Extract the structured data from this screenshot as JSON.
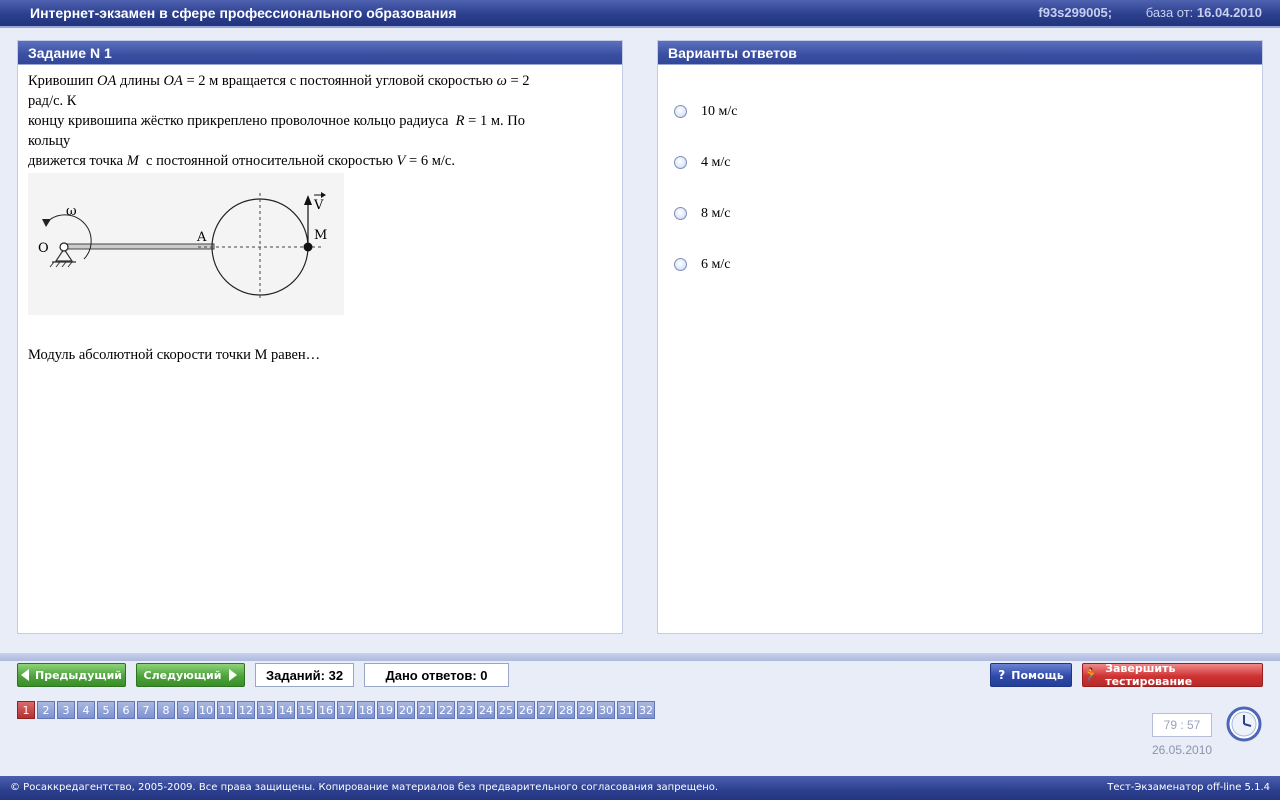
{
  "window": {
    "title": "Интернет-экзамен в сфере профессионального образования",
    "session_id": "f93s299005;",
    "base_label": "база от:",
    "base_date": "16.04.2010"
  },
  "task": {
    "header": "Задание N 1",
    "figure_labels": {
      "omega": "ω",
      "o": "O",
      "a": "A",
      "m": "M",
      "v": "V"
    },
    "question": "Модуль абсолютной скорости точки M равен…"
  },
  "answers": {
    "header": "Варианты ответов",
    "options": [
      "10 м/с",
      "4 м/с",
      "8 м/с",
      "6 м/с"
    ]
  },
  "toolbar": {
    "prev_label": "Предыдущий",
    "next_label": "Следующий",
    "tasks_count_label": "Заданий: 32",
    "answers_count_label": "Дано ответов: 0",
    "help_label": "Помощь",
    "finish_label": "Завершить тестирование"
  },
  "question_numbers": {
    "current": 1,
    "items": [
      "1",
      "2",
      "3",
      "4",
      "5",
      "6",
      "7",
      "8",
      "9",
      "10",
      "11",
      "12",
      "13",
      "14",
      "15",
      "16",
      "17",
      "18",
      "19",
      "20",
      "21",
      "22",
      "23",
      "24",
      "25",
      "26",
      "27",
      "28",
      "29",
      "30",
      "31",
      "32"
    ]
  },
  "timer": {
    "value": "79 : 57",
    "date": "26.05.2010"
  },
  "footer": {
    "copyright": "© Росаккредагентство, 2005-2009. Все права защищены. Копирование материалов без предварительного согласования запрещено.",
    "version": "Тест-Экзаменатор off-line 5.1.4"
  },
  "colors": {
    "current_question": "#b73030",
    "nav_button": "#4da33a",
    "help_button": "#2f4aa9",
    "finish_button": "#cf3434"
  }
}
